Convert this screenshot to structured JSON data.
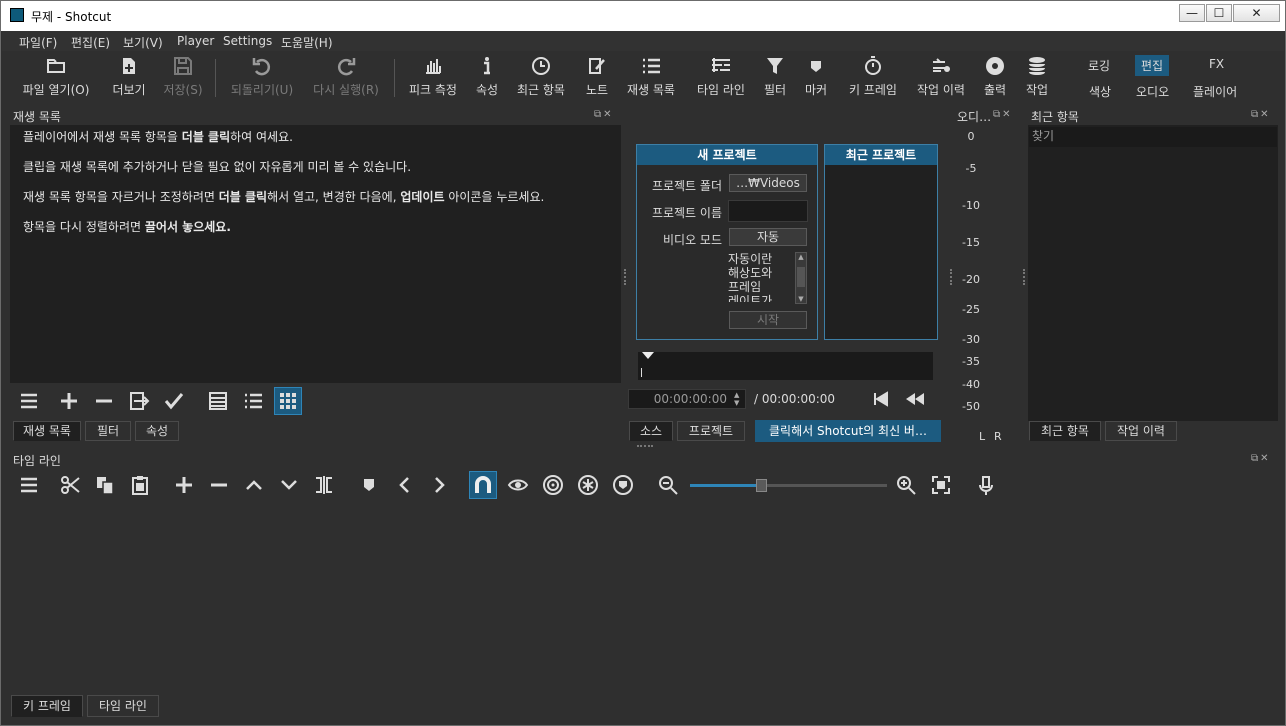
{
  "window": {
    "title": "무제 - Shotcut",
    "min": "—",
    "max": "☐",
    "close": "✕"
  },
  "menu": [
    "파일(F)",
    "편집(E)",
    "보기(V)",
    "Player",
    "Settings",
    "도움말(H)"
  ],
  "toolbar": {
    "open": "파일 열기(O)",
    "more": "더보기",
    "save": "저장(S)",
    "undo": "되돌리기(U)",
    "redo": "다시 실행(R)",
    "peak": "피크 측정",
    "props": "속성",
    "recent": "최근 항목",
    "notes": "노트",
    "playlist": "재생 목록",
    "timeline": "타임 라인",
    "filters": "필터",
    "markers": "마커",
    "keyframes": "키 프레임",
    "history": "작업 이력",
    "export": "출력",
    "jobs": "작업"
  },
  "layouts": {
    "logging": "로깅",
    "editing": "편집",
    "fx": "FX",
    "color": "색상",
    "audio": "오디오",
    "player": "플레이어"
  },
  "playlist": {
    "title": "재생 목록",
    "line1a": "플레이어에서 재생 목록 항목을 ",
    "line1b": "더블 클릭",
    "line1c": "하여 여세요.",
    "line2": "클립을 재생 목록에 추가하거나 닫을 필요 없이 자유롭게 미리 볼 수 있습니다.",
    "line3a": "재생 목록 항목을 자르거나 조정하려면 ",
    "line3b": "더블 클릭",
    "line3c": "해서 열고, 변경한 다음에, ",
    "line3d": "업데이트",
    "line3e": " 아이콘을 누르세요.",
    "line4a": "항목을 다시 정렬하려면 ",
    "line4b": "끌어서 놓으세요.",
    "tabs": [
      "재생 목록",
      "필터",
      "속성"
    ]
  },
  "newproject": {
    "header": "새 프로젝트",
    "folder_label": "프로젝트 폴더",
    "folder_value": "…₩Videos",
    "name_label": "프로젝트 이름",
    "mode_label": "비디오 모드",
    "mode_value": "자동",
    "desc_1": "자동이란",
    "desc_2": "해상도와",
    "desc_3": "프레임",
    "desc_4": "레이트가",
    "start": "시작"
  },
  "recentproject": {
    "header": "최근 프로젝트"
  },
  "player": {
    "timecode": "00:00:00:00",
    "duration": "/ 00:00:00:00",
    "tabs": [
      "소스",
      "프로젝트"
    ],
    "update_banner": "클릭해서 Shotcut의 최신 버…"
  },
  "audio": {
    "title": "오디…",
    "scale": [
      "0",
      "-5",
      "-10",
      "-15",
      "-20",
      "-25",
      "-30",
      "-35",
      "-40",
      "-50"
    ],
    "left": "L",
    "right": "R"
  },
  "recent": {
    "title": "최근 항목",
    "search_placeholder": "찾기",
    "tabs": [
      "최근 항목",
      "작업 이력"
    ]
  },
  "timeline": {
    "title": "타임 라인",
    "zoom": 0.36
  },
  "bottom_tabs": [
    "키 프레임",
    "타임 라인"
  ],
  "colors": {
    "accent": "#1c5b80",
    "panel": "#202020",
    "chrome": "#2f2f2f"
  }
}
